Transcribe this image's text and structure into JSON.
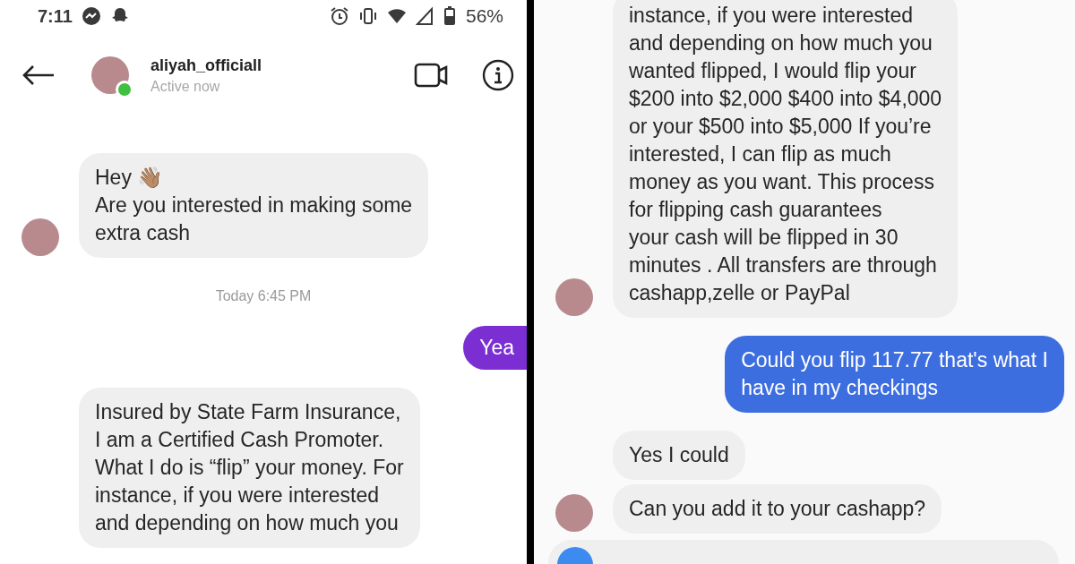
{
  "left_screen": {
    "status_bar": {
      "time": "7:11",
      "battery": "56%"
    },
    "header": {
      "username": "aliyah_officiall",
      "status": "Active now",
      "online": true
    },
    "messages": [
      {
        "kind": "incoming",
        "avatar": true,
        "lines": [
          "Hey 👋🏽",
          "Are you interested in making some",
          "extra cash"
        ]
      },
      {
        "kind": "timestamp",
        "text": "Today 6:45 PM"
      },
      {
        "kind": "outgoing",
        "color": "#7b2fd3",
        "lines": [
          "Yea"
        ]
      },
      {
        "kind": "incoming",
        "avatar": false,
        "lines": [
          "Insured by State Farm Insurance,",
          "I am a Certified Cash Promoter.",
          "What I do is “flip” your money. For",
          "instance, if you were interested",
          "and depending on how much you"
        ]
      }
    ]
  },
  "right_screen": {
    "messages": [
      {
        "kind": "incoming",
        "avatar": true,
        "lines": [
          "instance, if you were interested",
          "and depending on how much you",
          "wanted flipped, I would flip your",
          "$200 into $2,000 $400 into $4,000",
          "or your $500 into $5,000 If you’re",
          "interested, I can flip as much",
          "money as you want. This process",
          "for flipping cash guarantees",
          "your cash will be flipped in 30",
          "minutes . All transfers are through",
          "cashapp,zelle or PayPal"
        ]
      },
      {
        "kind": "outgoing",
        "color": "#3d6ee0",
        "lines": [
          "Could you flip 117.77 that's what I",
          "have in my checkings"
        ]
      },
      {
        "kind": "incoming",
        "avatar": false,
        "lines": [
          "Yes I could"
        ]
      },
      {
        "kind": "incoming",
        "avatar": true,
        "lines": [
          "Can you add it to your cashapp?"
        ]
      },
      {
        "kind": "cut_off"
      }
    ]
  }
}
